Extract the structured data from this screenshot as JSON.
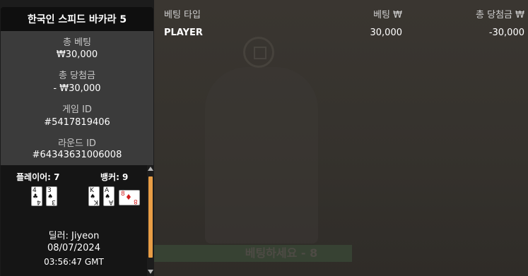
{
  "panel": {
    "title": "한국인 스피드 바카라 5",
    "total_bet_label": "총 베팅",
    "total_bet_value": "₩30,000",
    "total_win_label": "총 당첨금",
    "total_win_value": "- ₩30,000",
    "game_id_label": "게임 ID",
    "game_id_value": "#5417819406",
    "round_id_label": "라운드 ID",
    "round_id_value": "#64343631006008"
  },
  "result": {
    "player_label": "플레이어: 7",
    "banker_label": "뱅커: 9",
    "player_cards": [
      {
        "rank": "4",
        "suit": "♣",
        "color": "black"
      },
      {
        "rank": "3",
        "suit": "♠",
        "color": "black"
      }
    ],
    "banker_cards": [
      {
        "rank": "K",
        "suit": "♠",
        "color": "black"
      },
      {
        "rank": "A",
        "suit": "♠",
        "color": "black"
      },
      {
        "rank": "8",
        "suit": "♦",
        "color": "red"
      }
    ],
    "dealer": "딜러: Jiyeon",
    "date": "08/07/2024",
    "time": "03:56:47 GMT"
  },
  "table": {
    "headers": {
      "bet_type": "베팅 타입",
      "bet": "베팅 ₩",
      "win": "총 당첨금 ₩"
    },
    "rows": [
      {
        "bet_type": "PLAYER",
        "bet": "30,000",
        "win": "-30,000"
      }
    ]
  },
  "background": {
    "banner_text": "베팅하세요 - 8"
  },
  "colors": {
    "scroll_thumb": "#e89d45",
    "card_red": "#d21d1d"
  }
}
